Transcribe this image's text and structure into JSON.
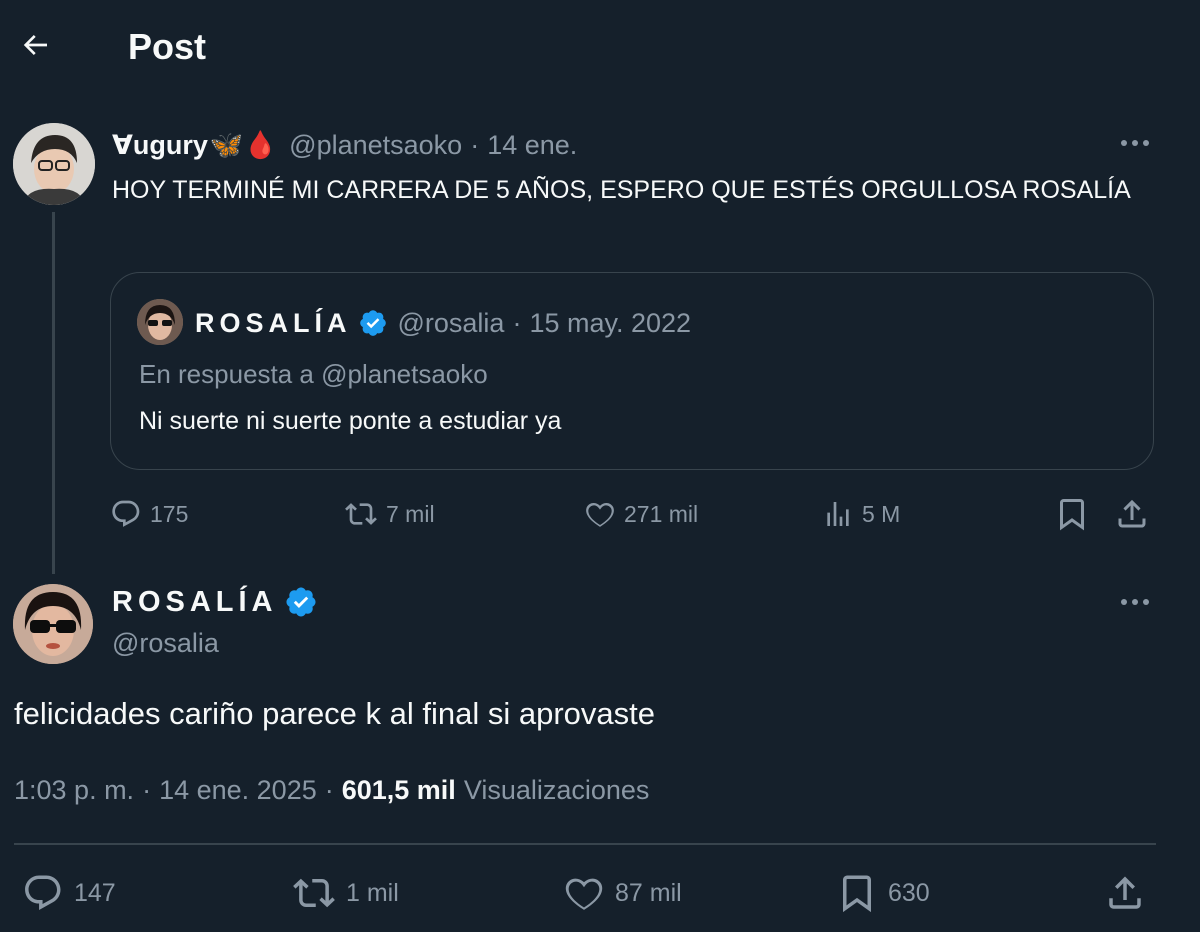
{
  "header": {
    "title": "Post"
  },
  "parent_post": {
    "display_name": "Ɐugury",
    "emoji": "🦋🩸",
    "handle": "@planetsaoko",
    "separator": "·",
    "date": "14 ene.",
    "text": "HOY TERMINÉ MI CARRERA DE 5 AÑOS, ESPERO QUE ESTÉS ORGULLOSA ROSALÍA",
    "quote": {
      "display_name": "ROSALÍA",
      "handle": "@rosalia",
      "separator": "·",
      "date": "15 may. 2022",
      "reply_to": "En respuesta a @planetsaoko",
      "text": "Ni suerte ni suerte ponte a estudiar ya"
    },
    "actions": {
      "replies": "175",
      "reposts": "7 mil",
      "likes": "271 mil",
      "views": "5 M"
    }
  },
  "main_post": {
    "display_name": "ROSALÍA",
    "handle": "@rosalia",
    "text": "felicidades cariño parece k al final si aprovaste",
    "time": "1:03 p. m.",
    "separator": "·",
    "date": "14 ene. 2025",
    "views_count": "601,5 mil",
    "views_label": "Visualizaciones",
    "actions": {
      "replies": "147",
      "reposts": "1 mil",
      "likes": "87 mil",
      "bookmarks": "630"
    }
  },
  "colors": {
    "background": "#15202b",
    "text": "#f7f9f9",
    "muted": "#8b98a5",
    "border": "#38444d",
    "verified": "#1d9bf0"
  }
}
